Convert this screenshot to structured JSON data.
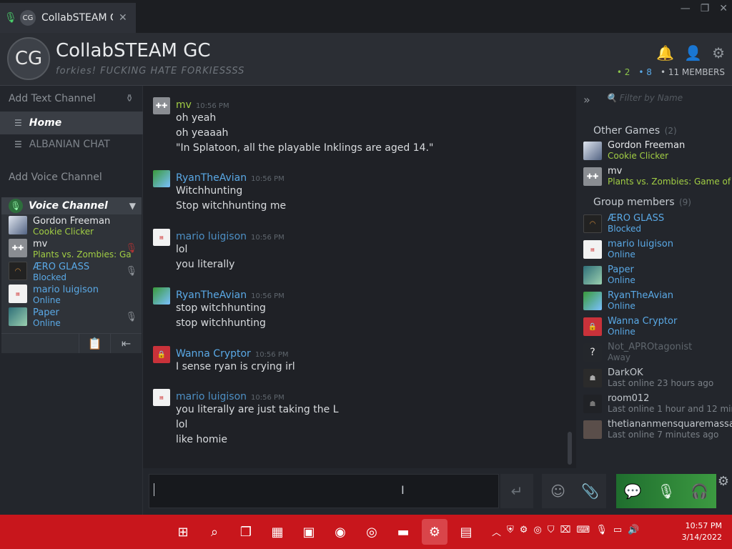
{
  "tab": {
    "title": "CollabSTEAM G",
    "avatar": "CG",
    "close": "✕"
  },
  "window_controls": [
    "—",
    "❐",
    "✕"
  ],
  "header": {
    "avatar": "CG",
    "title": "CollabSTEAM GC",
    "subtitle": "forkies! FUCKING HATE FORKIESSSS",
    "stat_ingame": "2",
    "stat_online": "8",
    "stat_members": "11 MEMBERS"
  },
  "left": {
    "add_text": "Add Text Channel",
    "home": "Home",
    "albanian": "ALBANIAN CHAT",
    "add_voice": "Add Voice Channel",
    "voice_title": "Voice Channel",
    "voice_members": [
      {
        "name": "Gordon Freeman",
        "status": "Cookie Clicker"
      },
      {
        "name": "mv",
        "status": "Plants vs. Zombies: Ga"
      },
      {
        "name": "ÆRO GLASS",
        "status": "Blocked"
      },
      {
        "name": "mario luigison",
        "status": "Online"
      },
      {
        "name": "Paper",
        "status": "Online"
      }
    ]
  },
  "messages": [
    {
      "who": "mv",
      "time": "10:56 PM",
      "lines": [
        "oh yeah",
        "oh yeaaah",
        "\"In Splatoon, all the playable Inklings are aged 14.\""
      ]
    },
    {
      "who": "RyanTheAvian",
      "time": "10:56 PM",
      "lines": [
        "Witchhunting",
        "Stop witchhunting me"
      ]
    },
    {
      "who": "mario luigison",
      "time": "10:56 PM",
      "lines": [
        "lol",
        "you literally"
      ]
    },
    {
      "who": "RyanTheAvian",
      "time": "10:56 PM",
      "lines": [
        "stop witchhunting",
        "stop witchhunting"
      ]
    },
    {
      "who": "Wanna Cryptor",
      "time": "10:56 PM",
      "lines": [
        "I sense ryan is crying irl"
      ]
    },
    {
      "who": "mario luigison",
      "time": "10:56 PM",
      "lines": [
        "you literally are just taking the L",
        "lol",
        "like homie"
      ]
    }
  ],
  "right": {
    "filter_placeholder": "Filter by Name",
    "other_games": "Other Games",
    "other_games_count": "(2)",
    "group_members": "Group members",
    "group_members_count": "(9)",
    "ingame": [
      {
        "name": "Gordon Freeman",
        "status": "Cookie Clicker"
      },
      {
        "name": "mv",
        "status": "Plants vs. Zombies: Game of t"
      }
    ],
    "members": [
      {
        "name": "ÆRO GLASS",
        "status": "Blocked"
      },
      {
        "name": "mario luigison",
        "status": "Online"
      },
      {
        "name": "Paper",
        "status": "Online"
      },
      {
        "name": "RyanTheAvian",
        "status": "Online"
      },
      {
        "name": "Wanna Cryptor",
        "status": "Online"
      },
      {
        "name": "Not_APROtagonist",
        "status": "Away"
      },
      {
        "name": "DarkOK",
        "status": "Last online 23 hours ago"
      },
      {
        "name": "room012",
        "status": "Last online 1 hour and 12 mir"
      },
      {
        "name": "thetiananmensquaremassa",
        "status": "Last online 7 minutes ago"
      }
    ]
  },
  "clock": {
    "time": "10:57 PM",
    "date": "3/14/2022"
  }
}
